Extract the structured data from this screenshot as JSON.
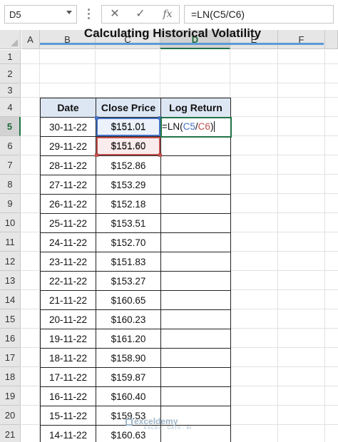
{
  "name_box": "D5",
  "formula_bar": {
    "cancel_icon": "x-icon",
    "enter_icon": "check-icon",
    "function_icon": "fx-icon",
    "value": "=LN(C5/C6)"
  },
  "columns": [
    "A",
    "B",
    "C",
    "D",
    "E",
    "F"
  ],
  "rows": [
    "1",
    "2",
    "3",
    "4",
    "5",
    "6",
    "7",
    "8",
    "9",
    "10",
    "11",
    "12",
    "13",
    "14",
    "15",
    "16",
    "17",
    "18",
    "19",
    "20",
    "21"
  ],
  "title": "Calculating Historical Volatility",
  "table": {
    "headers": [
      "Date",
      "Close Price",
      "Log Return"
    ],
    "rows": [
      {
        "date": "30-11-22",
        "price": "$151.01"
      },
      {
        "date": "29-11-22",
        "price": "$151.60"
      },
      {
        "date": "28-11-22",
        "price": "$152.86"
      },
      {
        "date": "27-11-22",
        "price": "$153.29"
      },
      {
        "date": "26-11-22",
        "price": "$152.18"
      },
      {
        "date": "25-11-22",
        "price": "$153.51"
      },
      {
        "date": "24-11-22",
        "price": "$152.70"
      },
      {
        "date": "23-11-22",
        "price": "$151.83"
      },
      {
        "date": "22-11-22",
        "price": "$153.27"
      },
      {
        "date": "21-11-22",
        "price": "$160.65"
      },
      {
        "date": "20-11-22",
        "price": "$160.23"
      },
      {
        "date": "19-11-22",
        "price": "$161.20"
      },
      {
        "date": "18-11-22",
        "price": "$158.90"
      },
      {
        "date": "17-11-22",
        "price": "$159.87"
      },
      {
        "date": "16-11-22",
        "price": "$160.40"
      },
      {
        "date": "15-11-22",
        "price": "$159.53"
      },
      {
        "date": "14-11-22",
        "price": "$160.63"
      }
    ]
  },
  "edit_cell": {
    "prefix": "=LN(",
    "ref1": "C5",
    "slash": "/",
    "ref2": "C6",
    "suffix": ")"
  },
  "watermark": {
    "name": "exceldemy",
    "tagline": "EXCEL · DATA · BI"
  },
  "colors": {
    "header_fill": "#dde7f4",
    "title_rule": "#5b9bd5",
    "ref_blue": "#4472c4",
    "ref_red": "#c0504d",
    "active_border": "#217346"
  }
}
